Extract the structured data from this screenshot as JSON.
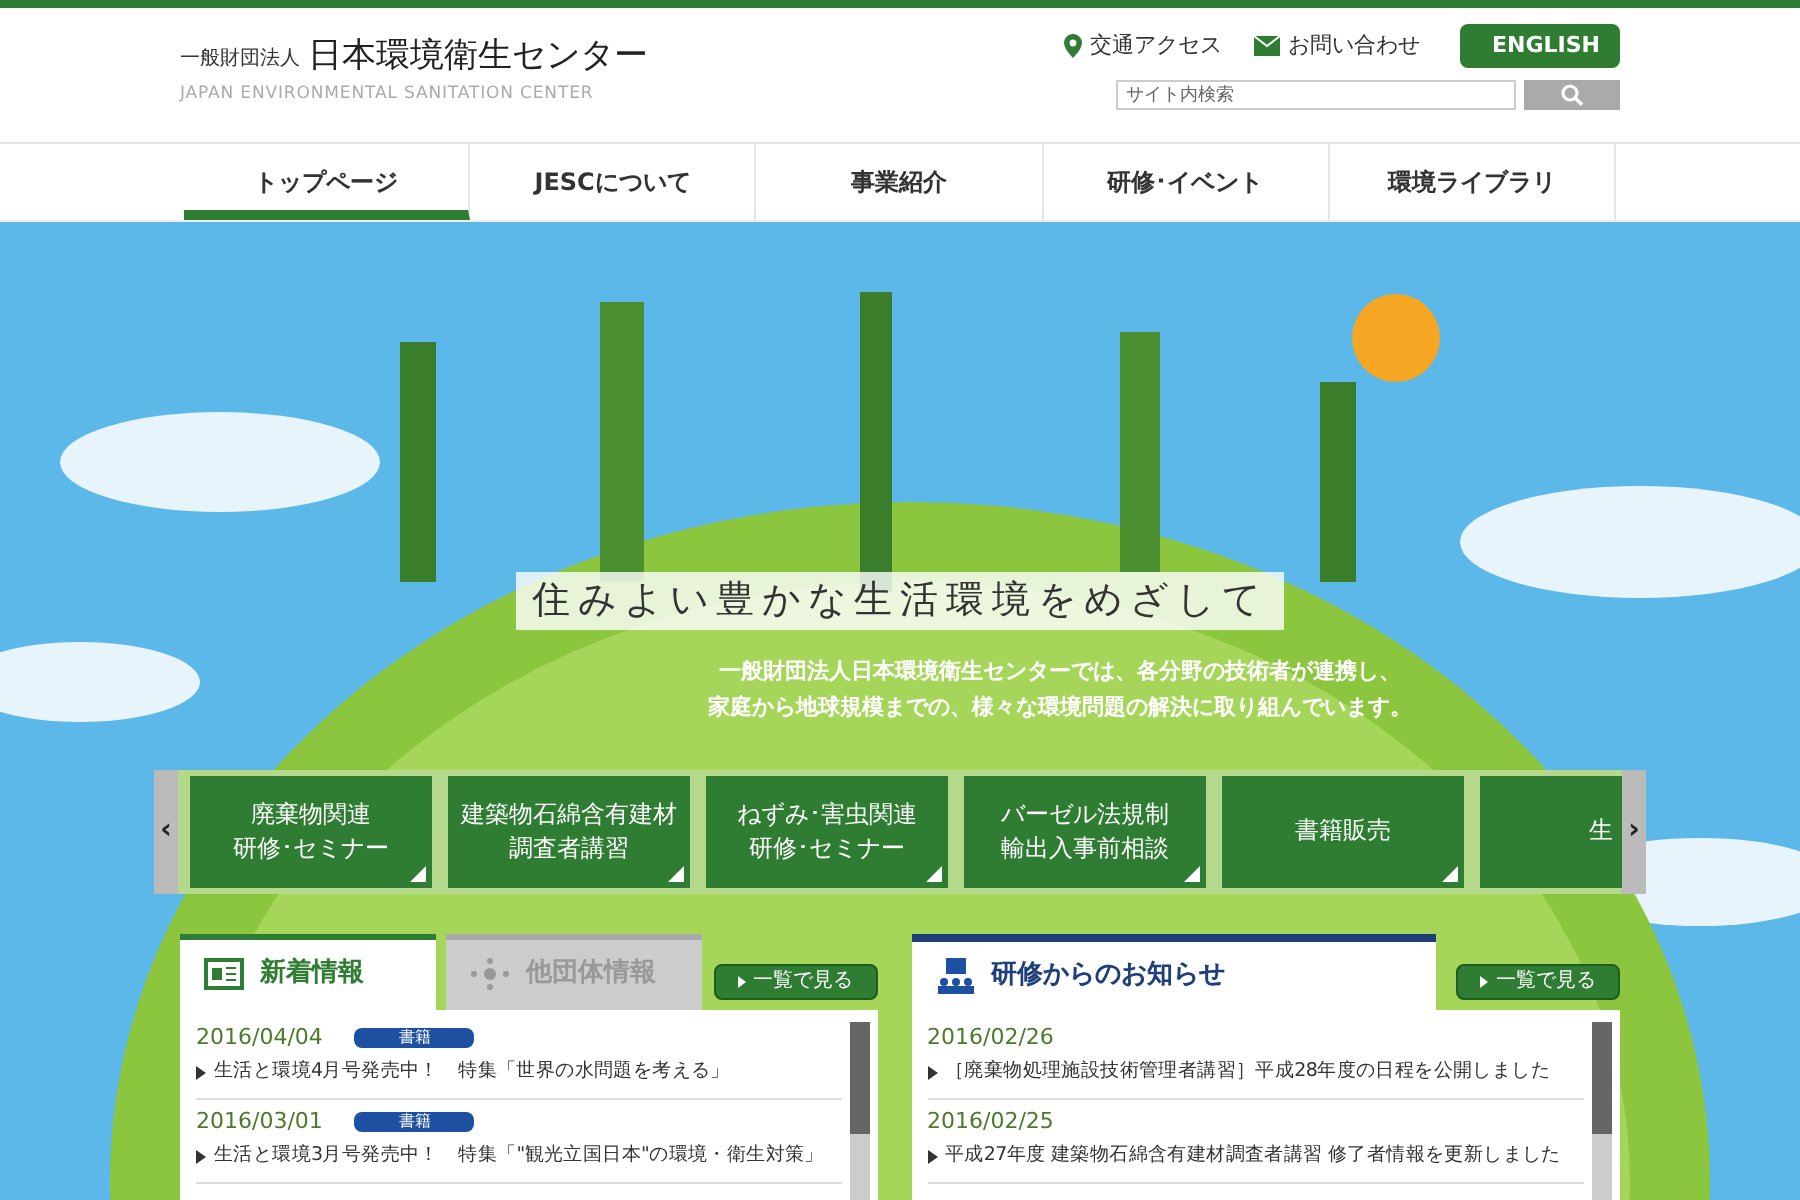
{
  "header": {
    "org_prefix": "一般財団法人",
    "org_name": "日本環境衛生センター",
    "org_english": "JAPAN ENVIRONMENTAL SANITATION CENTER",
    "links": [
      {
        "kind": "pin",
        "label": "交通アクセス"
      },
      {
        "kind": "mail",
        "label": "お問い合わせ"
      }
    ],
    "english_button": "ENGLISH",
    "search": {
      "placeholder": "サイト内検索"
    }
  },
  "nav": [
    {
      "label": "トップページ",
      "selected": true
    },
    {
      "label": "JESCについて",
      "selected": false
    },
    {
      "label": "事業紹介",
      "selected": false
    },
    {
      "label": "研修･イベント",
      "selected": false
    },
    {
      "label": "環境ライブラリ",
      "selected": false
    }
  ],
  "hero": {
    "headline": "住みよい豊かな生活環境をめざして",
    "lines": [
      "一般財団法人日本環境衛生センターでは、各分野の技術者が連携し、",
      "家庭から地球規模までの、様々な環境問題の解決に取り組んでいます。"
    ]
  },
  "carousel": {
    "prev": "‹",
    "next": "›",
    "items": [
      {
        "lines": [
          "廃棄物関連",
          "研修･セミナー"
        ]
      },
      {
        "lines": [
          "建築物石綿含有建材",
          "調査者講習"
        ]
      },
      {
        "lines": [
          "ねずみ･害虫関連",
          "研修･セミナー"
        ]
      },
      {
        "lines": [
          "バーゼル法規制",
          "輸出入事前相談"
        ]
      },
      {
        "lines": [
          "書籍販売"
        ]
      },
      {
        "lines": [
          "生"
        ]
      }
    ]
  },
  "news_panel": {
    "tabs": [
      {
        "label": "新着情報",
        "selected": true
      },
      {
        "label": "他団体情報",
        "selected": false
      }
    ],
    "more": "一覧で見る",
    "items": [
      {
        "date": "2016/04/04",
        "badge": "書籍",
        "text": "生活と環境4月号発売中！　特集「世界の水問題を考える」"
      },
      {
        "date": "2016/03/01",
        "badge": "書籍",
        "text": "生活と環境3月号発売中！　特集「\"観光立国日本\"の環境・衛生対策」"
      }
    ]
  },
  "training_panel": {
    "title": "研修からのお知らせ",
    "more": "一覧で見る",
    "items": [
      {
        "date": "2016/02/26",
        "text": "［廃棄物処理施設技術管理者講習］平成28年度の日程を公開しました"
      },
      {
        "date": "2016/02/25",
        "text": "平成27年度 建築物石綿含有建材調査者講習 修了者情報を更新しました"
      }
    ]
  }
}
